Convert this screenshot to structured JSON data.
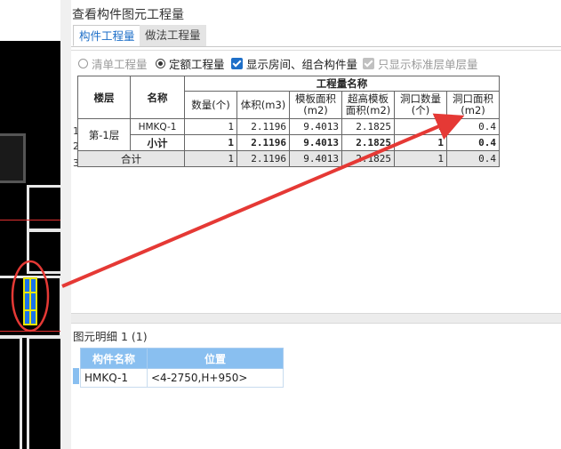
{
  "dialog": {
    "title": "查看构件图元工程量",
    "tabs": [
      {
        "label": "构件工程量",
        "active": true
      },
      {
        "label": "做法工程量",
        "active": false
      }
    ],
    "options": [
      {
        "label": "清单工程量",
        "type": "radio",
        "checked": false,
        "enabled": false
      },
      {
        "label": "定额工程量",
        "type": "radio",
        "checked": true,
        "enabled": true
      },
      {
        "label": "显示房间、组合构件量",
        "type": "checkbox",
        "checked": true,
        "enabled": true
      },
      {
        "label": "只显示标准层单层量",
        "type": "checkbox",
        "checked": true,
        "enabled": false
      }
    ]
  },
  "quantity_table": {
    "group_header": "工程量名称",
    "floor_header": "楼层",
    "name_header": "名称",
    "columns": [
      "数量(个)",
      "体积(m3)",
      "模板面积(m2)",
      "超高模板面积(m2)",
      "洞口数量(个)",
      "洞口面积(m2)"
    ],
    "row_numbers": [
      "1",
      "2",
      "3"
    ],
    "floor": "第-1层",
    "rows": [
      {
        "name": "HMKQ-1",
        "values": [
          "1",
          "2.1196",
          "9.4013",
          "2.1825",
          "1",
          "0.4"
        ]
      },
      {
        "name": "小计",
        "values": [
          "1",
          "2.1196",
          "9.4013",
          "2.1825",
          "1",
          "0.4"
        ]
      }
    ],
    "total": {
      "label": "合计",
      "values": [
        "1",
        "2.1196",
        "9.4013",
        "2.1825",
        "1",
        "0.4"
      ]
    }
  },
  "detail": {
    "label": "图元明细",
    "count": "1 (1)",
    "headers": [
      "构件名称",
      "位置"
    ],
    "row": {
      "name": "HMKQ-1",
      "position": "<4-2750,H+950>"
    }
  },
  "colors": {
    "accent": "#1e6fc8",
    "detail_header": "#89bff0",
    "annotation_red": "#e53935",
    "highlight_fill": "#1b73e8",
    "highlight_border": "#e6e600"
  }
}
